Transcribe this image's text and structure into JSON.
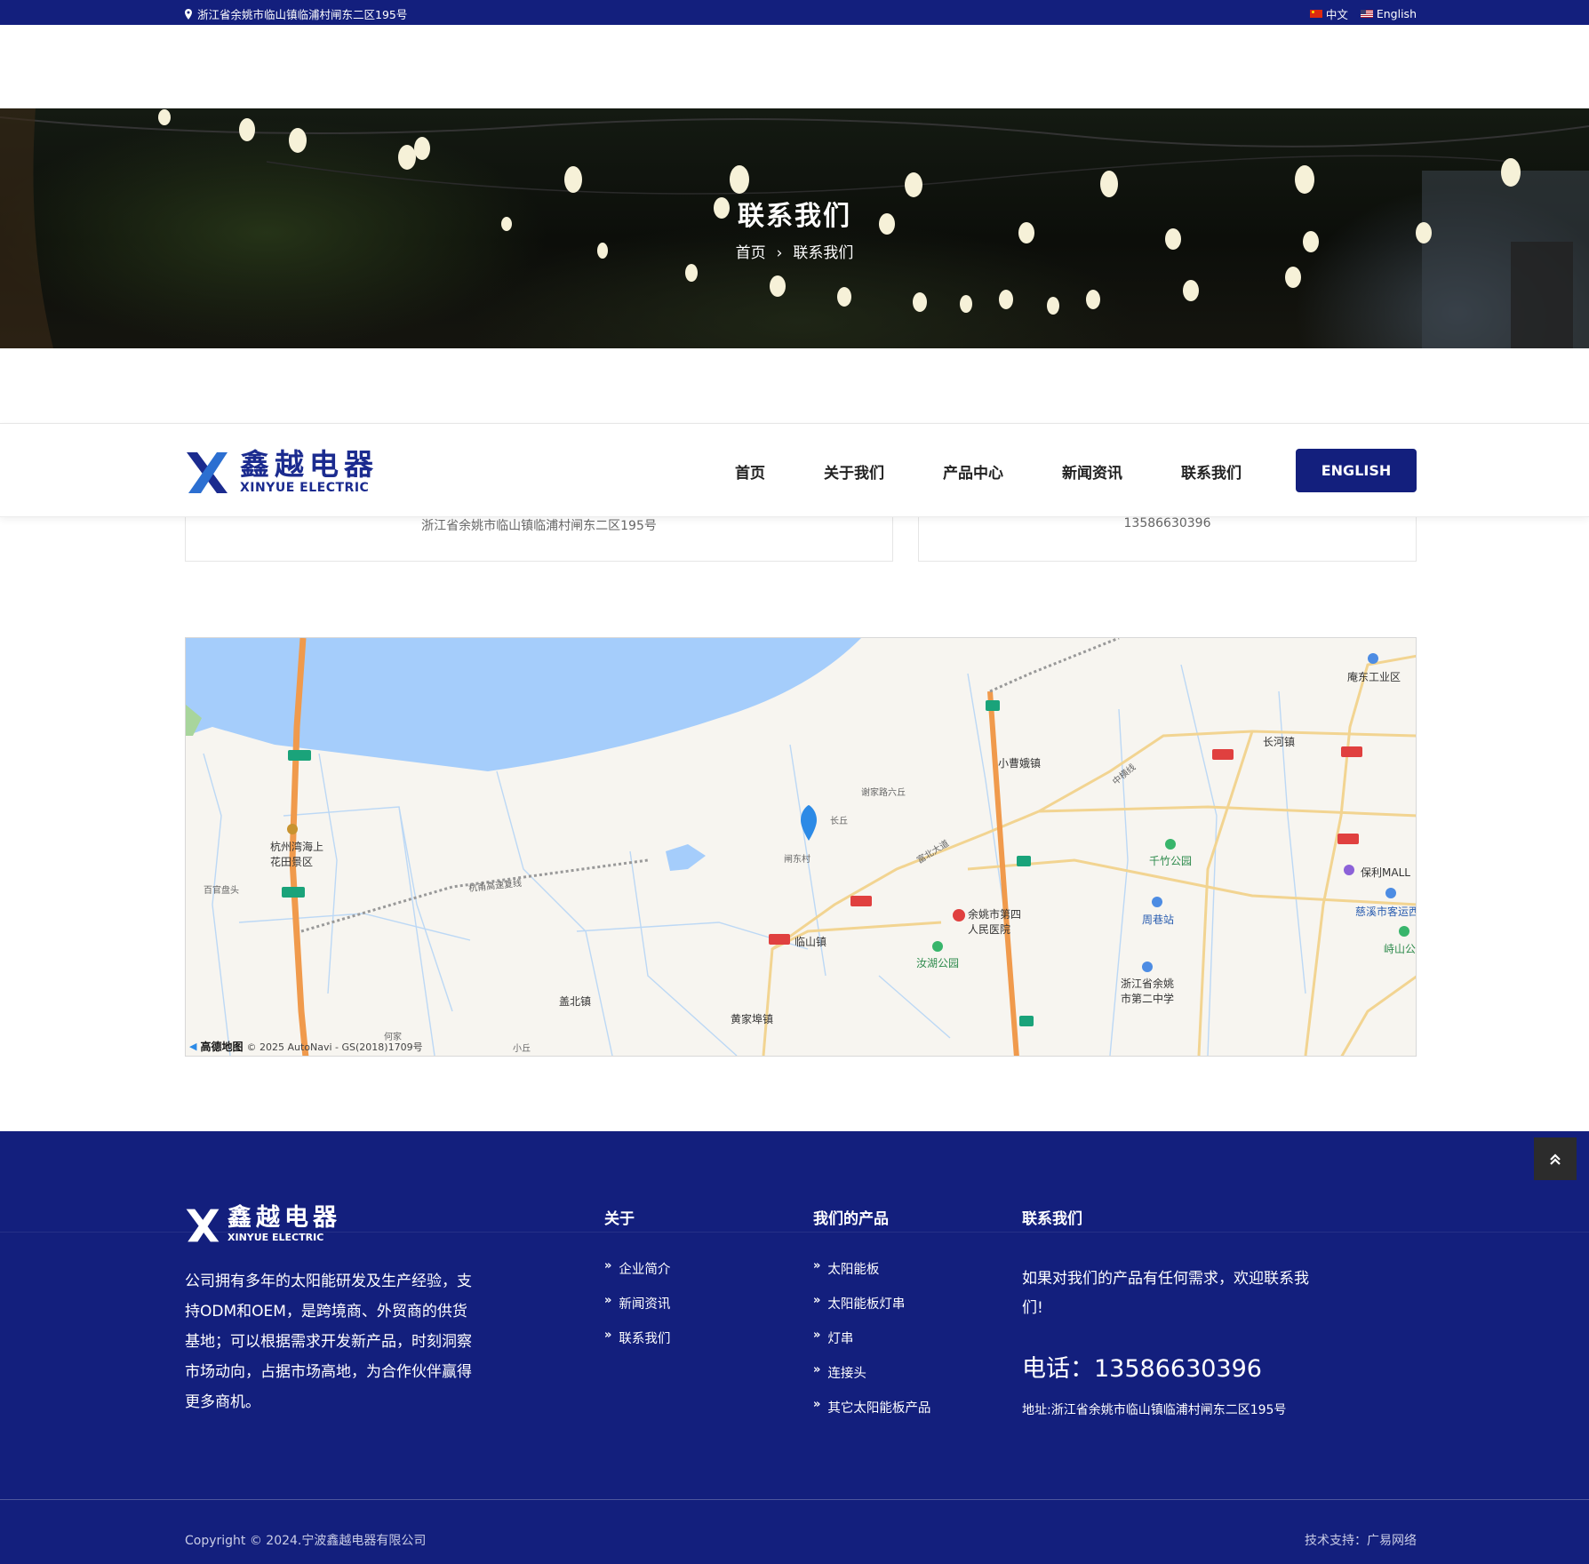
{
  "topbar": {
    "address": "浙江省余姚市临山镇临浦村闸东二区195号",
    "lang_cn": "中文",
    "lang_en": "English"
  },
  "hero": {
    "title": "联系我们",
    "breadcrumb_home": "首页",
    "breadcrumb_sep": "›",
    "breadcrumb_current": "联系我们"
  },
  "header": {
    "logo_cn": "鑫越电器",
    "logo_en": "XINYUE ELECTRIC",
    "nav": [
      "首页",
      "关于我们",
      "产品中心",
      "新闻资讯",
      "联系我们"
    ],
    "english_button": "ENGLISH"
  },
  "cards": {
    "address": "浙江省余姚市临山镇临浦村闸东二区195号",
    "phone": "13586630396"
  },
  "map": {
    "labels": {
      "hangzhou_bay": "杭州湾海上花田景区",
      "baiguanpan": "百官盘头",
      "linshan": "临山镇",
      "zhadong": "闸东村",
      "lutai": "长丘",
      "xiemen": "谢家路六丘",
      "qianzhu": "千竹公园",
      "ruhu": "汝湖公园",
      "hospital": "余姚市第四人民医院",
      "zhouxiang": "周巷站",
      "school": "浙江省余姚市第二中学",
      "cixi_station": "慈溪市客运西",
      "baoli": "保利MALL",
      "andong": "庵东工业区",
      "changhe": "长河镇",
      "xiaocao": "小曹娥镇",
      "gaibei": "盖北镇",
      "huangjiabu": "黄家埠镇",
      "highway": "杭甬高速复线",
      "fulun": "富北大道",
      "zhongheng": "中横线",
      "xiushan": "峙山公",
      "xiaoli": "小丘",
      "hejia": "何家"
    },
    "credit_brand": "高德地图",
    "credit_text": "© 2025 AutoNavi - GS(2018)1709号"
  },
  "footer": {
    "logo_cn": "鑫越电器",
    "logo_en": "XINYUE ELECTRIC",
    "about_text": "公司拥有多年的太阳能研发及生产经验，支持ODM和OEM，是跨境商、外贸商的供货基地；可以根据需求开发新产品，时刻洞察市场动向，占据市场高地，为合作伙伴赢得更多商机。",
    "col_about_title": "关于",
    "col_about_items": [
      "企业简介",
      "新闻资讯",
      "联系我们"
    ],
    "col_products_title": "我们的产品",
    "col_products_items": [
      "太阳能板",
      "太阳能板灯串",
      "灯串",
      "连接头",
      "其它太阳能板产品"
    ],
    "col_contact_title": "联系我们",
    "contact_text": "如果对我们的产品有任何需求，欢迎联系我们!",
    "phone": "电话：13586630396",
    "address": "地址:浙江省余姚市临山镇临浦村闸东二区195号",
    "copyright": "Copyright © 2024.宁波鑫越电器有限公司",
    "support": "技术支持：广易网络"
  },
  "colors": {
    "brand_navy": "#131f7d",
    "logo_blue": "#1b2b8f"
  }
}
